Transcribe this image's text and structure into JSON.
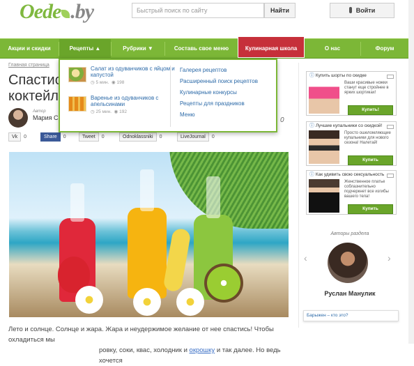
{
  "header": {
    "logo_main": "Oede",
    "logo_tld": ".by",
    "search_placeholder": "Быстрый поиск по сайту",
    "search_button": "Найти",
    "login_button": "Войти"
  },
  "nav": {
    "items": [
      {
        "label": "Акции и скидки"
      },
      {
        "label": "Рецепты ▲"
      },
      {
        "label": "Рубрики ▼"
      },
      {
        "label": "Составь свое меню"
      },
      {
        "label": "Кулинарная школа"
      },
      {
        "label": "О нас"
      },
      {
        "label": "Форум"
      }
    ]
  },
  "dropdown": {
    "recipes": [
      {
        "title": "Салат из одуванчиков с яйцом и капустой",
        "time": "5 мин.",
        "views": "198"
      },
      {
        "title": "Варенье из одуванчиков с апельсинами",
        "time": "25 мин.",
        "views": "192"
      }
    ],
    "links": [
      "Галерея рецептов",
      "Расширенный поиск рецептов",
      "Кулинарные конкурсы",
      "Рецепты для праздников",
      "Меню"
    ]
  },
  "article": {
    "breadcrumb": "Главная страница",
    "title_line1": "Спастись",
    "title_line2": "коктейле",
    "author_label": "Автор",
    "author_name": "Мария С",
    "count_right": "0",
    "body_line1": "Лето и солнце. Солнце и жара. Жара и неудержимое желание от нее спастись! Чтобы охладиться мы",
    "body_line2a": "ровку, соки, квас, холодник и ",
    "body_line2_link": "окрошку",
    "body_line2b": " и так далее. Но ведь хочется"
  },
  "share": [
    {
      "label": "Vk",
      "count": "0"
    },
    {
      "label": "Share",
      "count": "0"
    },
    {
      "label": "Tweet",
      "count": "0"
    },
    {
      "label": "Odnoklassniki",
      "count": "0"
    },
    {
      "label": "LiveJournal",
      "count": "0"
    }
  ],
  "sidebar": {
    "ads": [
      {
        "headline": "Купить шорты по скидке",
        "desc": "Ваши красивые ножки станут еще стройнее в ярких шортиках!",
        "button": "Купить!"
      },
      {
        "headline": "Лучшие купальники со скидкой!",
        "desc": "Просто ошеломляющие купальники для нового сезона! Налетай!",
        "button": "Купить"
      },
      {
        "headline": "Как удивить свою сексуальность",
        "desc": "Женственное платье соблазнительно подчеркнет все изгибы вашего тела!",
        "button": "Купить"
      }
    ],
    "authors_label": "Авторы раздела",
    "author_name": "Руслан Манулик",
    "baryah": "Барыжен – кто это?"
  },
  "colors": {
    "nav_green": "#7cb737",
    "school_red": "#c6303a",
    "link_blue": "#2c6aa8"
  }
}
